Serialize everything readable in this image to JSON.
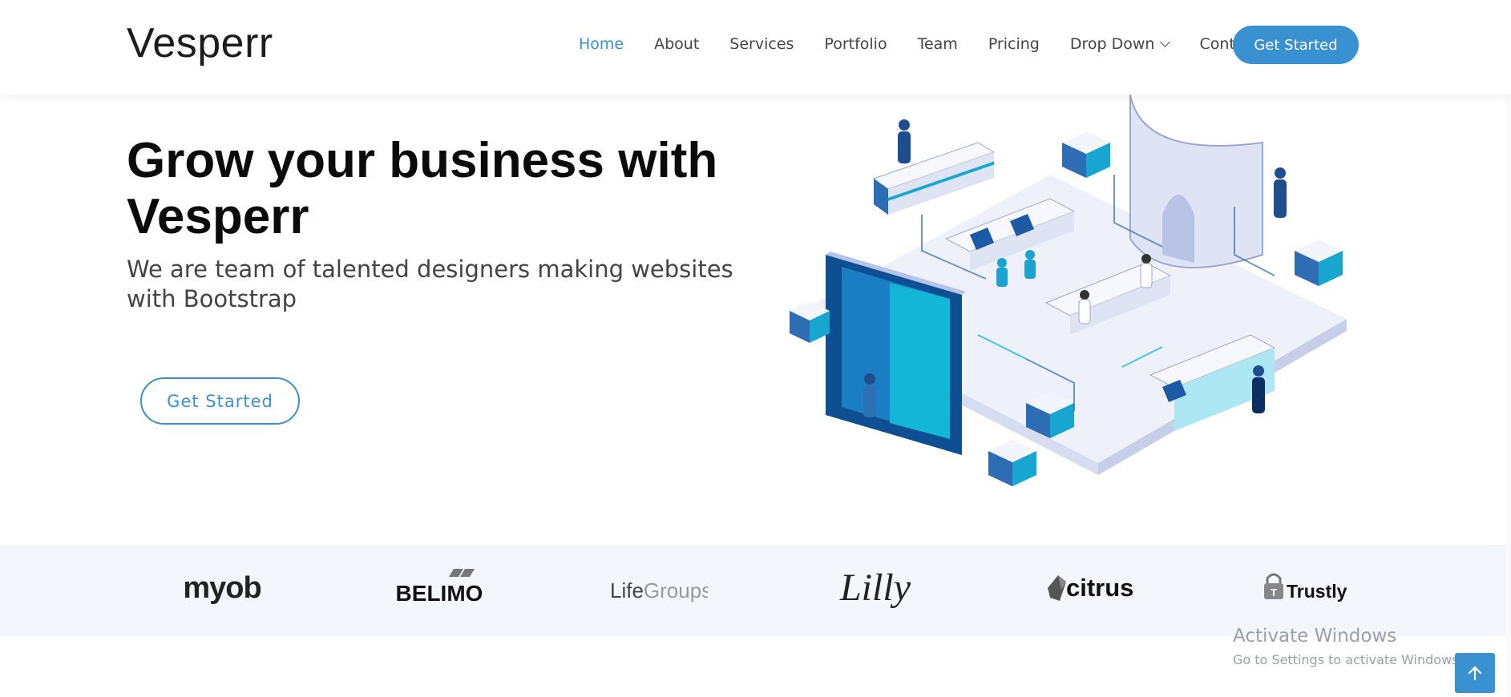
{
  "brand": {
    "logo_text": "Vesperr"
  },
  "nav": {
    "items": [
      {
        "label": "Home",
        "active": true
      },
      {
        "label": "About",
        "active": false
      },
      {
        "label": "Services",
        "active": false
      },
      {
        "label": "Portfolio",
        "active": false
      },
      {
        "label": "Team",
        "active": false
      },
      {
        "label": "Pricing",
        "active": false
      },
      {
        "label": "Drop Down",
        "active": false,
        "has_dropdown": true
      },
      {
        "label": "Contact",
        "active": false
      }
    ],
    "cta_label": "Get Started"
  },
  "hero": {
    "title_line1": "Grow your business with",
    "title_line2": "Vesperr",
    "subtitle": "We are team of talented designers making websites with Bootstrap",
    "button_label": "Get Started"
  },
  "clients": {
    "logos": [
      "myob",
      "BELIMO",
      "LifeGroups",
      "Lilly",
      "citrus",
      "Trustly"
    ]
  },
  "watermark": {
    "title": "Activate Windows",
    "subtitle": "Go to Settings to activate Windows."
  },
  "icons": {
    "dropdown": "chevron-down-icon",
    "back_to_top": "arrow-up-icon"
  },
  "colors": {
    "accent": "#3a91d1",
    "clients_bg": "#f3f7fb"
  }
}
